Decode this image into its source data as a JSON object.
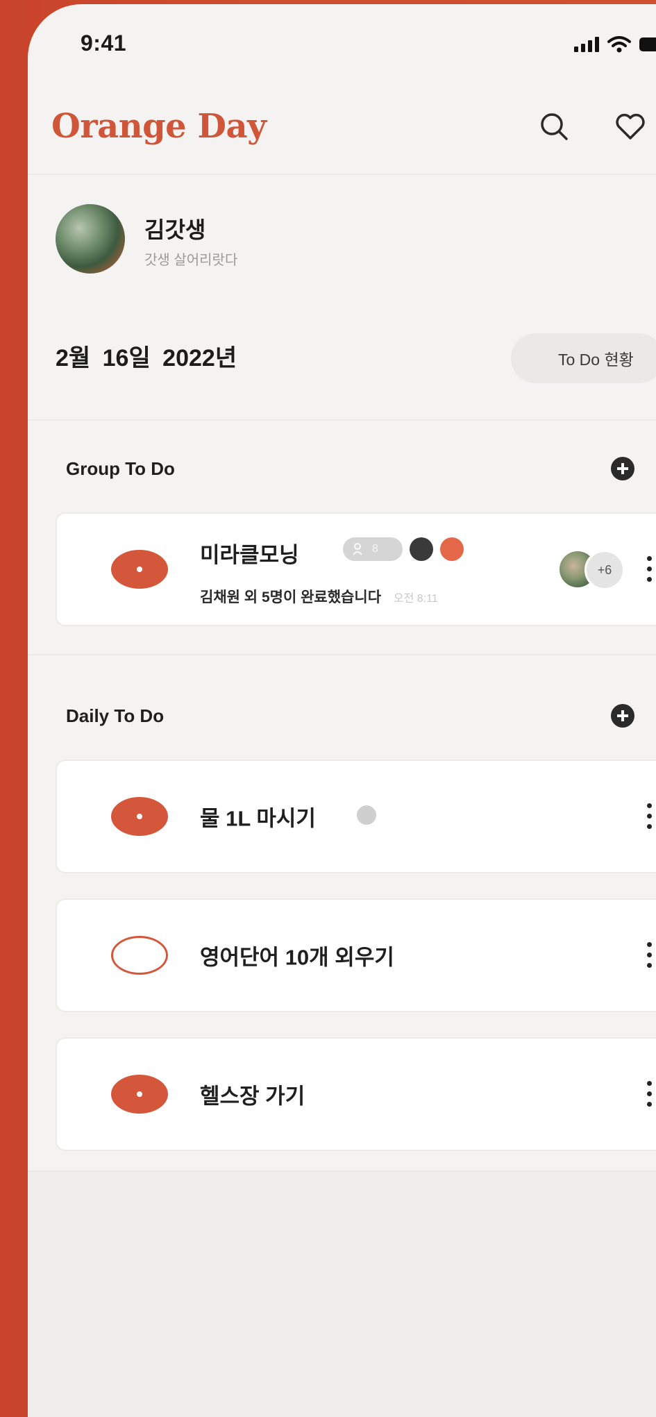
{
  "status_bar": {
    "time": "9:41"
  },
  "header": {
    "app_title": "Orange Day"
  },
  "profile": {
    "name": "김갓생",
    "status": "갓생 살어리랏다"
  },
  "date_row": {
    "date": "2월 16일  2022년",
    "status_button": "To Do 현황"
  },
  "group_todo": {
    "section_title": "Group To Do",
    "items": [
      {
        "title": "미라클모닝",
        "member_count": "8",
        "subtitle": "김채원 외 5명이 완료했습니다",
        "time": "오전 8:11",
        "more_members": "+6",
        "done": true
      }
    ]
  },
  "daily_todo": {
    "section_title": "Daily To Do",
    "items": [
      {
        "title": "물 1L 마시기",
        "done": true
      },
      {
        "title": "영어단어 10개 외우기",
        "done": false
      },
      {
        "title": "헬스장 가기",
        "done": true
      }
    ]
  },
  "colors": {
    "brand": "#d0563a",
    "check": "#d4573c",
    "background": "#f4f3f1"
  }
}
